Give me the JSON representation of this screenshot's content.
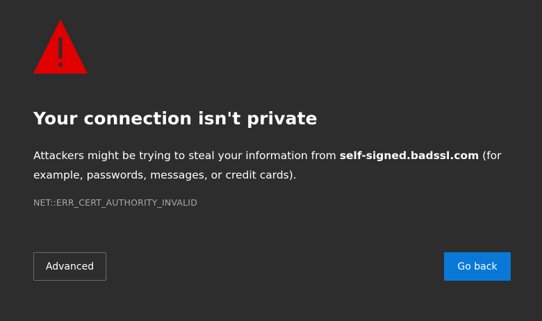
{
  "interstitial": {
    "heading": "Your connection isn't private",
    "message_prefix": "Attackers might be trying to steal your information from ",
    "host": "self-signed.badssl.com",
    "message_suffix": " (for example, passwords, messages, or credit cards).",
    "error_code": "NET::ERR_CERT_AUTHORITY_INVALID",
    "icon": "warning-triangle-icon"
  },
  "buttons": {
    "advanced_label": "Advanced",
    "back_label": "Go back"
  },
  "colors": {
    "background": "#2d2d2d",
    "warning": "#e00000",
    "primary_button": "#0a78d7",
    "error_code_text": "#a8a8a8"
  }
}
